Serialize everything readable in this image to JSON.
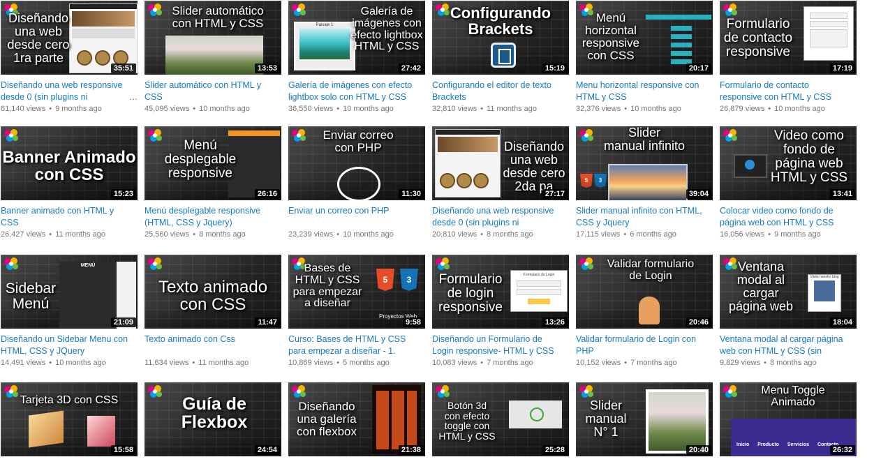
{
  "videos": [
    {
      "thumb_text": "Diseñando\nuna web\ndesde cero\n1ra parte",
      "duration": "35:51",
      "title": "Diseñando una web responsive desde 0 (sin plugins ni",
      "views": "61,140 views",
      "age": "9 months ago",
      "more": "…"
    },
    {
      "thumb_text": "Slider automático\ncon HTML y CSS",
      "duration": "13:53",
      "title": "Slider automático con HTML y CSS",
      "views": "45,095 views",
      "age": "10 months ago"
    },
    {
      "thumb_text": "Galería de\nimágenes con\nefecto lightbox\nHTML y CSS",
      "duration": "27:42",
      "title": "Galería de imágenes con efecto lightbox solo con HTML y CSS",
      "views": "36,550 views",
      "age": "10 months ago",
      "art_caption": "Paisaje 1"
    },
    {
      "thumb_text": "Configurando\nBrackets",
      "duration": "15:19",
      "title": "Configurando el editor de texto Brackets",
      "views": "32,810 views",
      "age": "11 months ago"
    },
    {
      "thumb_text": "Menú\nhorizontal\nresponsive\ncon CSS",
      "duration": "20:17",
      "title": "Menu horizontal responsive con HTML y CSS",
      "views": "32,376 views",
      "age": "10 months ago"
    },
    {
      "thumb_text": "Formulario\nde contacto\nresponsive",
      "duration": "17:19",
      "title": "Formulario de contacto responsive con HTML y CSS",
      "views": "26,879 views",
      "age": "10 months ago"
    },
    {
      "thumb_text": "Banner Animado\ncon CSS",
      "duration": "15:23",
      "title": "Banner animado con HTML y CSS",
      "views": "26,427 views",
      "age": "11 months ago"
    },
    {
      "thumb_text": "Menú\ndesplegable\nresponsive",
      "duration": "26:16",
      "title": "Menú desplegable responsive (HTML, CSS y Jquery)",
      "views": "25,560 views",
      "age": "8 months ago"
    },
    {
      "thumb_text": "Enviar correo\ncon PHP",
      "duration": "11:30",
      "title": "Enviar un correo con PHP",
      "views": "23,239 views",
      "age": "10 months ago"
    },
    {
      "thumb_text": "Diseñando\nuna web\ndesde cero\n2da pa",
      "duration": "27:17",
      "title": "Diseñando una web responsive desde 0 (sin plugins ni",
      "views": "20,810 views",
      "age": "8 months ago"
    },
    {
      "thumb_text": "Slider\nmanual infinito",
      "duration": "39:04",
      "title": "Slider manual infinito con HTML, CSS y Jquery",
      "views": "17,115 views",
      "age": "6 months ago"
    },
    {
      "thumb_text": "Video como\nfondo de\npágina web\nHTML y CSS",
      "duration": "13:41",
      "title": "Colocar video como fondo de página web con HTML y CSS",
      "views": "16,056 views",
      "age": "9 months ago"
    },
    {
      "thumb_text": "Sidebar\nMenú",
      "duration": "21:09",
      "title": "Diseñando un Sidebar Menu con HTML, CSS y JQuery",
      "views": "14,491 views",
      "age": "10 months ago",
      "art_caption": "MENÚ"
    },
    {
      "thumb_text": "Texto animado\ncon CSS",
      "duration": "11:47",
      "title": "Texto animado con Css",
      "views": "11,634 views",
      "age": "11 months ago"
    },
    {
      "thumb_text": "Bases de\nHTML y CSS\npara empezar\na diseñar",
      "duration": "9:58",
      "title": "Curso: Bases de HTML y CSS para empezar a diseñar - 1.",
      "views": "10,869 views",
      "age": "5 months ago",
      "art_caption": "Proyectos Web"
    },
    {
      "thumb_text": "Formulario\nde login\nresponsive",
      "duration": "13:26",
      "title": "Diseñando un Formulario de Login responsive- HTML y CSS",
      "views": "10,083 views",
      "age": "7 months ago",
      "art_caption": "Formulario de Login"
    },
    {
      "thumb_text": "Validar formulario\nde Login",
      "duration": "20:46",
      "title": "Validar formulario de Login con PHP",
      "views": "10,152 views",
      "age": "7 months ago"
    },
    {
      "thumb_text": "Ventana\nmodal al\ncargar\npágina web",
      "duration": "18:04",
      "title": "Ventana modal al cargar página web con HTML y CSS (sin plugin…",
      "views": "9,829 views",
      "age": "8 months ago",
      "art_caption": "Visita nuestro blog"
    },
    {
      "thumb_text": "Tarjeta 3D con CSS",
      "duration": "15:58",
      "title": "",
      "views": "",
      "age": ""
    },
    {
      "thumb_text": "Guía de\nFlexbox",
      "duration": "24:54",
      "title": "",
      "views": "",
      "age": ""
    },
    {
      "thumb_text": "Diseñando\nuna galería\ncon flexbox",
      "duration": "21:38",
      "title": "",
      "views": "",
      "age": ""
    },
    {
      "thumb_text": "Botón 3d\ncon efecto\ntoggle con\nHTML y CSS",
      "duration": "25:28",
      "title": "",
      "views": "",
      "age": ""
    },
    {
      "thumb_text": "Slider\nmanual\nN° 1",
      "duration": "20:40",
      "title": "",
      "views": "",
      "age": ""
    },
    {
      "thumb_text": "Menu Toggle\nAnimado",
      "duration": "26:32",
      "title": "",
      "views": "",
      "age": "",
      "art_caption": [
        "Inicio",
        "Producto",
        "Servicios",
        "Contacto"
      ]
    }
  ],
  "colors": {
    "title": "#167ac6",
    "meta": "#767676",
    "accent": "#2ab1c0"
  }
}
